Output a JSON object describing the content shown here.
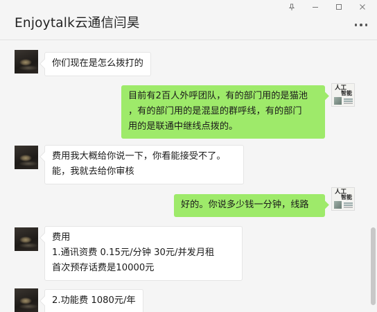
{
  "window": {
    "title": "Enjoytalk云通信闫昊",
    "controls": [
      "pin-icon",
      "minimize-icon",
      "maximize-icon",
      "close-icon"
    ]
  },
  "messages": [
    {
      "sender": "other",
      "lines": [
        "你们现在是怎么拨打的"
      ]
    },
    {
      "sender": "me",
      "lines": [
        "目前有2百人外呼团队，有的部门用的是猫池",
        "，有的部门用的是混显的群呼线，有的部门",
        "用的是联通中继线点拨的。"
      ]
    },
    {
      "sender": "other",
      "lines": [
        "费用我大概给你说一下，你看能接受不了。",
        "能，我就去给你审核"
      ]
    },
    {
      "sender": "me",
      "lines": [
        "好的。你说多少钱一分钟，线路"
      ]
    },
    {
      "sender": "other",
      "lines": [
        "费用",
        "1.通讯资费  0.15元/分钟   30元/并发月租",
        "首次预存话费是10000元"
      ]
    },
    {
      "sender": "other",
      "lines": [
        "2.功能费  1080元/年"
      ]
    }
  ],
  "my_avatar_text": {
    "top": "人工",
    "mid": "智能"
  },
  "colors": {
    "outgoing_bubble": "#9eea6a",
    "incoming_bubble": "#ffffff",
    "background": "#f5f5f5"
  }
}
